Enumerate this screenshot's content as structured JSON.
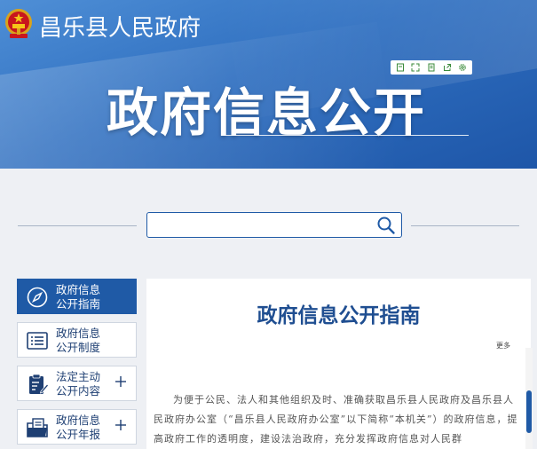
{
  "header": {
    "site_title": "昌乐县人民政府",
    "banner_heading": "政府信息公开",
    "toolbar": [
      {
        "name": "accessibility-icon"
      },
      {
        "name": "fullscreen-icon"
      },
      {
        "name": "print-icon"
      },
      {
        "name": "share-icon"
      },
      {
        "name": "settings-icon"
      }
    ]
  },
  "search": {
    "placeholder": "",
    "value": ""
  },
  "sidebar": {
    "items": [
      {
        "label": "政府信息\n公开指南",
        "icon": "compass-icon",
        "active": true,
        "expandable": false
      },
      {
        "label": "政府信息\n公开制度",
        "icon": "list-document-icon",
        "active": false,
        "expandable": false
      },
      {
        "label": "法定主动\n公开内容",
        "icon": "clipboard-edit-icon",
        "active": false,
        "expandable": true
      },
      {
        "label": "政府信息\n公开年报",
        "icon": "folder-document-icon",
        "active": false,
        "expandable": true
      }
    ]
  },
  "main": {
    "title": "政府信息公开指南",
    "more": "更多",
    "body": "为便于公民、法人和其他组织及时、准确获取昌乐县人民政府及昌乐县人民政府办公室（“昌乐县人民政府办公室”以下简称“本机关”）的政府信息，提高政府工作的透明度，建设法治政府，充分发挥政府信息对人民群"
  },
  "colors": {
    "brand": "#1f5aa6",
    "title": "#1f4e91",
    "banner": "#2f6fc0"
  }
}
